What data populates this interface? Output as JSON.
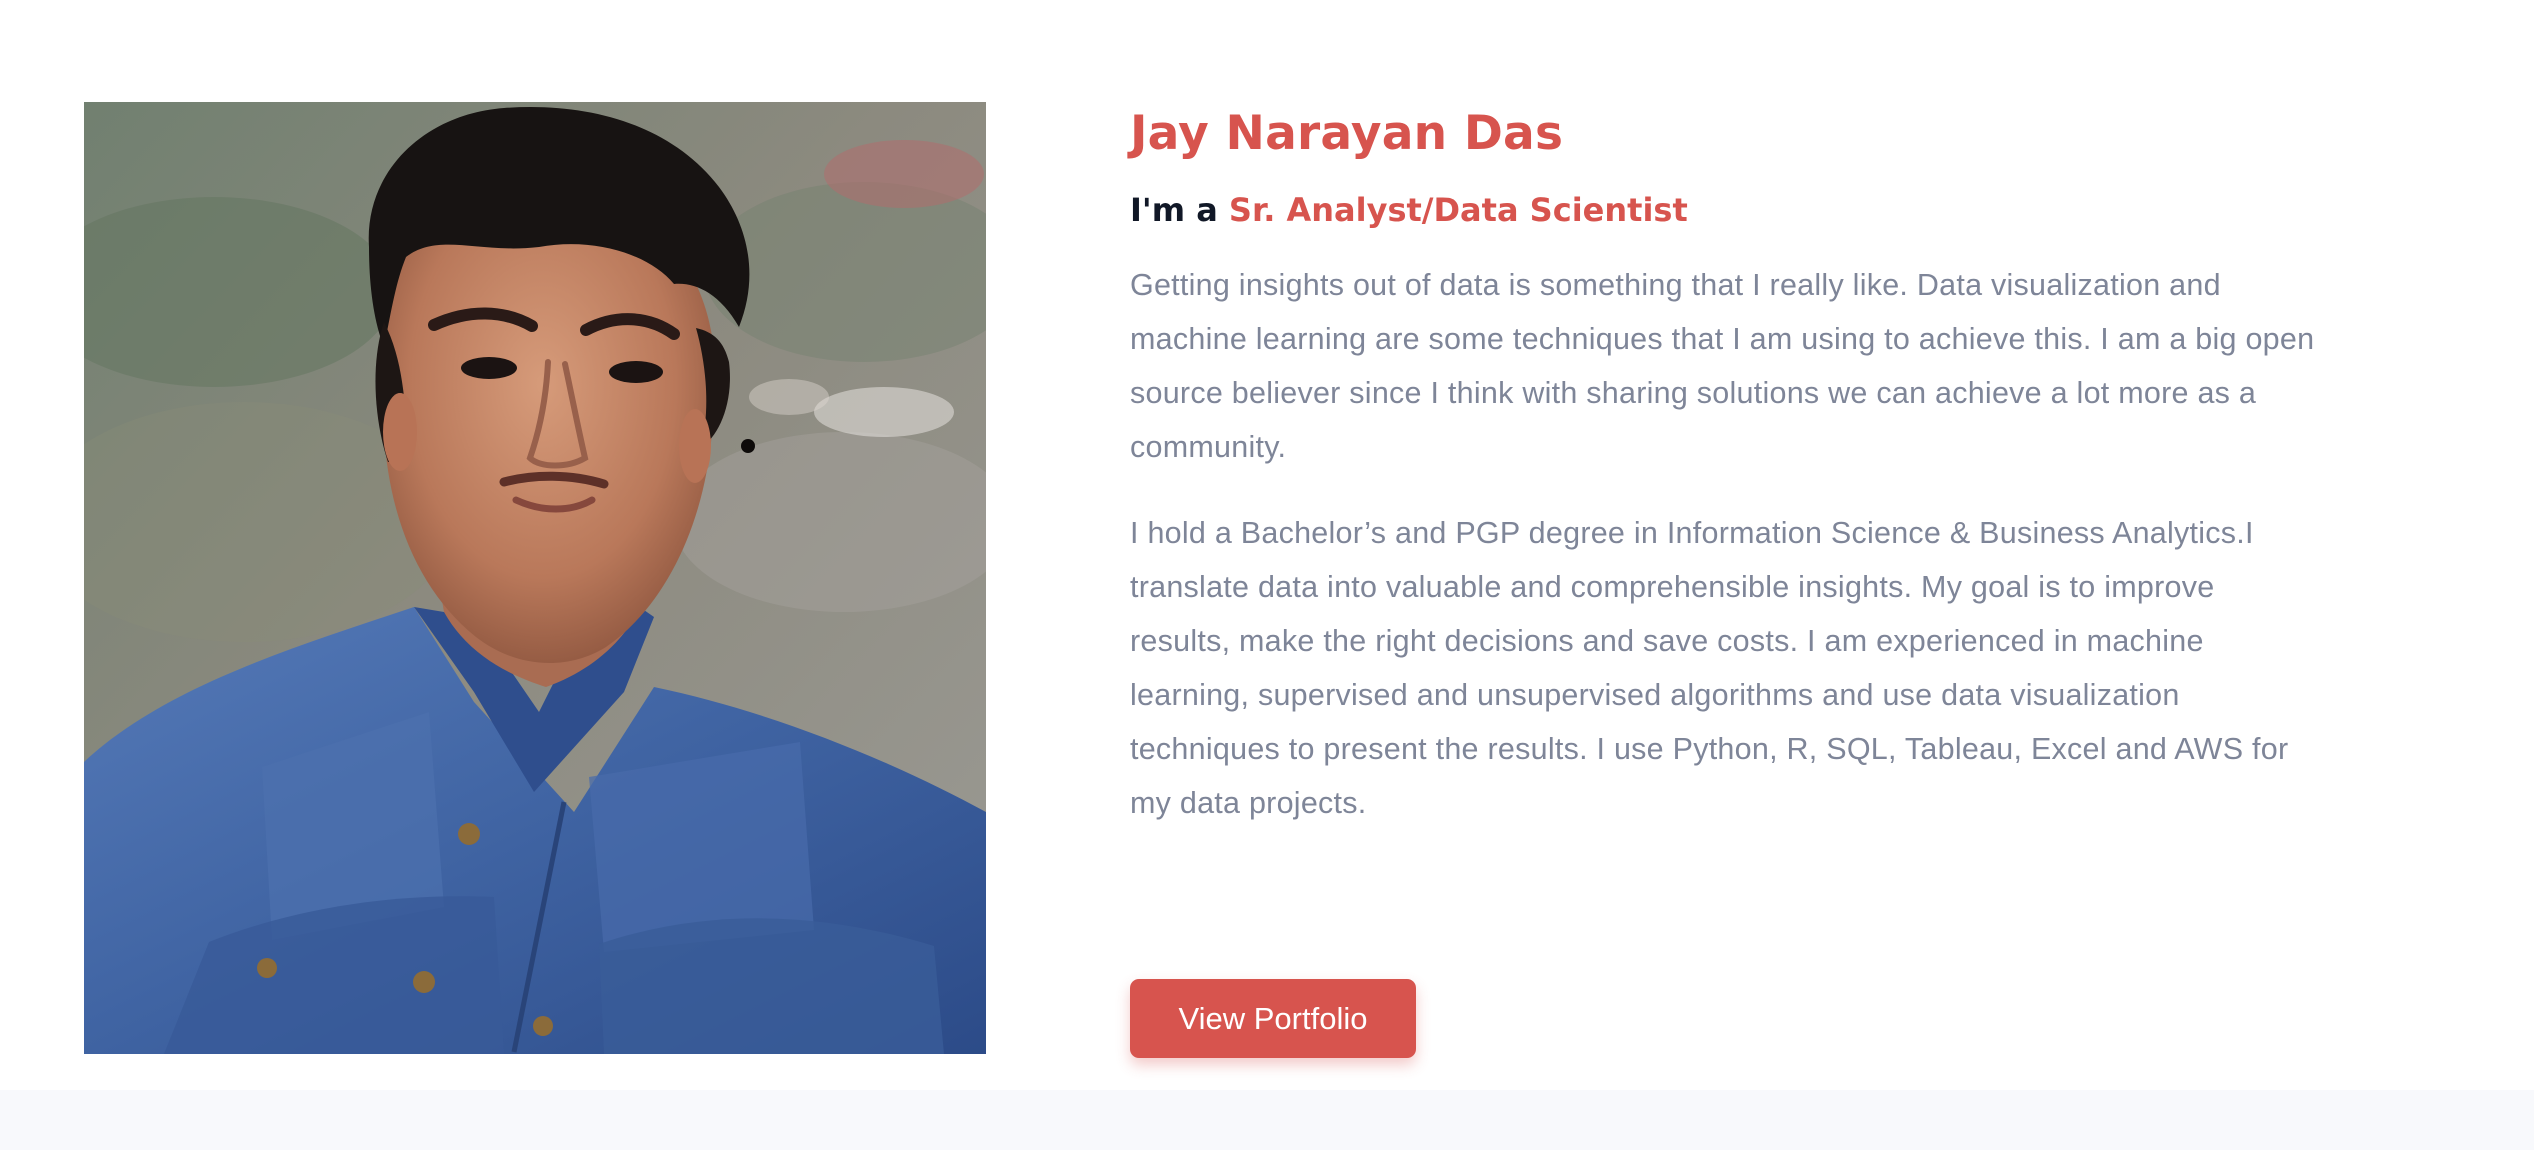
{
  "profile": {
    "name": "Jay Narayan Das",
    "role_prefix": "I'm a",
    "role": "Sr. Analyst/Data Scientist",
    "bio": [
      "Getting insights out of data is something that I really like. Data visualization and machine learning are some techniques that I am using to achieve this. I am a big open source believer since I think with sharing solutions we can achieve a lot more as a community.",
      "I hold a Bachelor’s and PGP degree in Information Science & Business Analytics.I translate data into valuable and comprehensible insights. My goal is to improve results, make the right decisions and save costs. I am experienced in machine learning, supervised and unsupervised algorithms and use data visualization techniques to present the results. I use Python, R, SQL, Tableau, Excel and AWS for my data projects."
    ],
    "button_label": "View Portfolio"
  },
  "colors": {
    "accent": "#d7544e",
    "heading_dark": "#111827",
    "body_text": "#7e8598",
    "page_background": "#ffffff",
    "bottom_band": "#f8f9fc"
  }
}
